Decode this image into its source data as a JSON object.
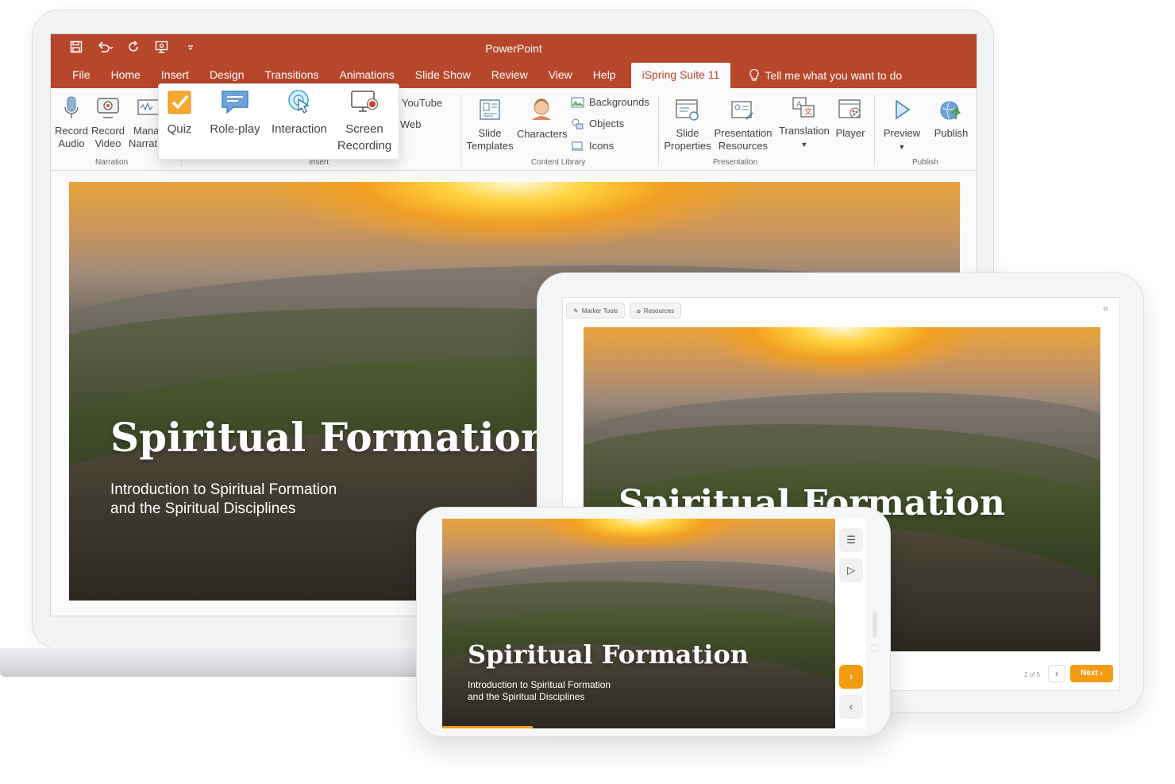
{
  "powerpoint": {
    "app_title": "PowerPoint",
    "quick_access": {
      "save_icon": "save-icon",
      "undo_icon": "undo-icon",
      "redo_icon": "redo-icon",
      "slideshow_icon": "present-icon",
      "more_icon": "customize-icon"
    },
    "tabs": [
      "File",
      "Home",
      "Insert",
      "Design",
      "Transitions",
      "Animations",
      "Slide Show",
      "Review",
      "View",
      "Help"
    ],
    "active_tab": "iSpring Suite 11",
    "tell_me": "Tell me what you want to do",
    "ribbon": {
      "narration": {
        "label": "Narration",
        "record_audio": [
          "Record",
          "Audio"
        ],
        "record_video": [
          "Record",
          "Video"
        ],
        "manage_narration": [
          "Mana",
          "Narrat"
        ]
      },
      "insert": {
        "label": "Insert",
        "youtube": "YouTube",
        "web": "Web",
        "popup": {
          "quiz": "Quiz",
          "role_play": "Role-play",
          "interaction": "Interaction",
          "screen_recording": [
            "Screen",
            "Recording"
          ]
        }
      },
      "content_library": {
        "label": "Content Library",
        "slide_templates": [
          "Slide",
          "Templates"
        ],
        "characters": "Characters",
        "backgrounds": "Backgrounds",
        "objects": "Objects",
        "icons": "Icons"
      },
      "presentation": {
        "label": "Presentation",
        "slide_properties": [
          "Slide",
          "Properties"
        ],
        "presentation_resources": [
          "Presentation",
          "Resources"
        ],
        "translation": "Translation",
        "player": "Player"
      },
      "publish": {
        "label": "Publish",
        "preview": "Preview",
        "publish": "Publish"
      }
    }
  },
  "slide": {
    "title": "Spiritual Formation",
    "subtitle_line1": "Introduction to Spiritual Formation",
    "subtitle_line2": "and the Spiritual Disciplines"
  },
  "tablet": {
    "marker_tools": "Marker Tools",
    "resources": "Resources",
    "slide_counter": "2 of 5",
    "next_label": "Next",
    "title": "Spiritual Formation"
  },
  "phone": {
    "progress": 0.23
  },
  "colors": {
    "ribbon_accent": "#b7472a",
    "orange": "#f39c12"
  }
}
